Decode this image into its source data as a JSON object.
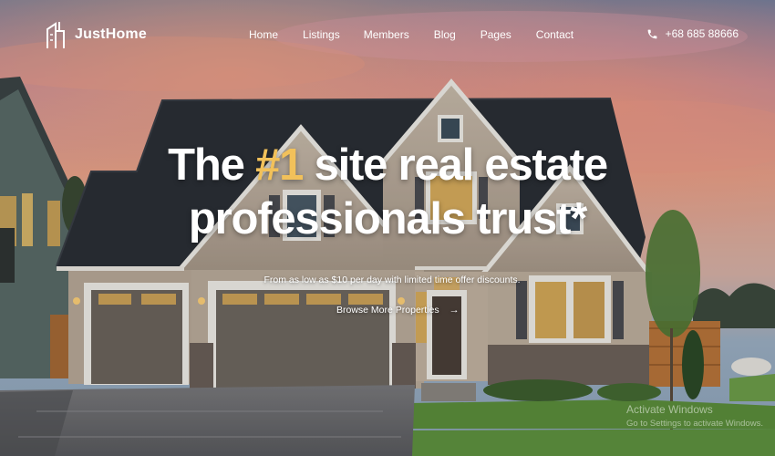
{
  "brand": {
    "name": "JustHome"
  },
  "nav": {
    "items": [
      {
        "label": "Home"
      },
      {
        "label": "Listings"
      },
      {
        "label": "Members"
      },
      {
        "label": "Blog"
      },
      {
        "label": "Pages"
      },
      {
        "label": "Contact"
      }
    ]
  },
  "contact": {
    "phone": "+68 685 88666",
    "icon": "phone-icon"
  },
  "hero": {
    "title_before": "The ",
    "title_highlight": "#1",
    "title_after": " site real estate",
    "title_line2": "professionals trust*",
    "subtitle": "From as low as $10 per day with limited time offer discounts.",
    "cta_label": "Browse More Properties",
    "cta_icon": "arrow-right-icon"
  },
  "watermark": {
    "line1": "Activate Windows",
    "line2": "Go to Settings to activate Windows."
  },
  "colors": {
    "highlight": "#f2c15a",
    "text": "#ffffff"
  }
}
